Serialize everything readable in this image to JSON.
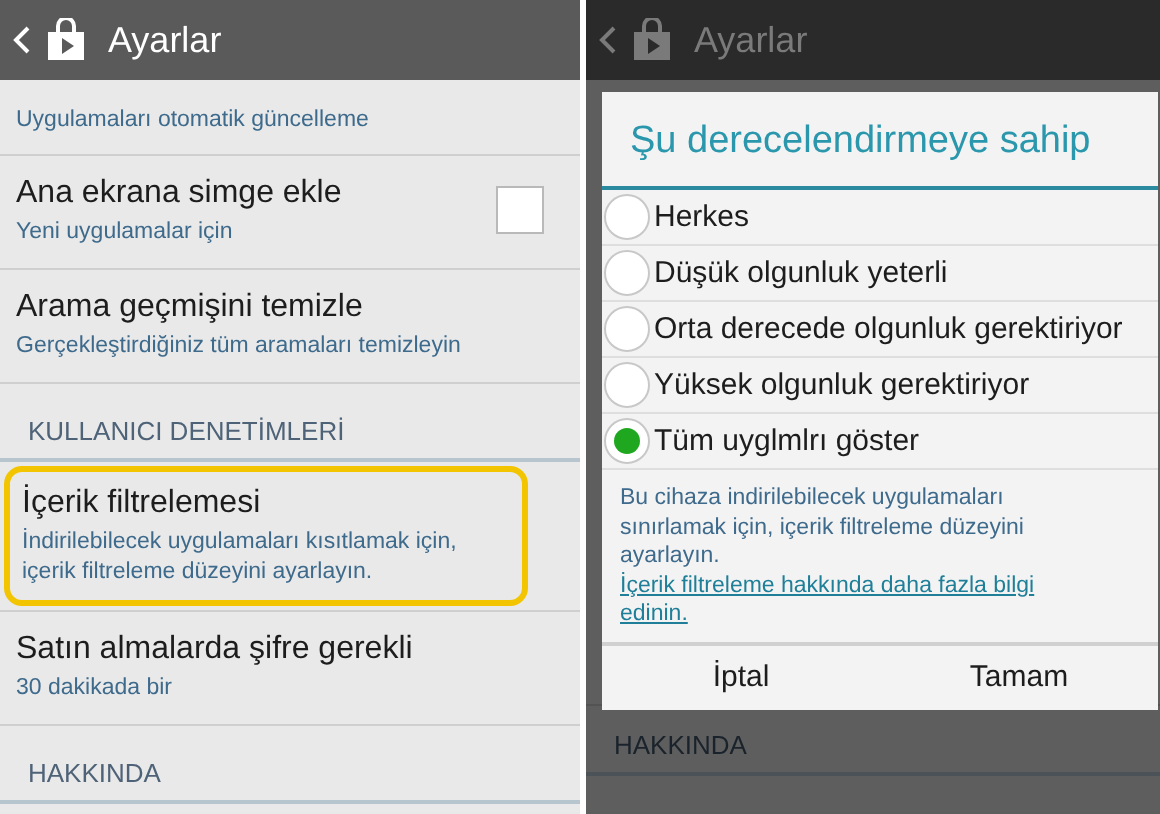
{
  "left_screen": {
    "action_bar": {
      "title": "Ayarlar"
    },
    "items": [
      {
        "kind": "item",
        "subtitle": "Uygulamaları otomatik güncelleme"
      },
      {
        "kind": "item",
        "title": "Ana ekrana simge ekle",
        "subtitle": "Yeni uygulamalar için",
        "checkbox": {
          "checked": false
        }
      },
      {
        "kind": "item",
        "title": "Arama geçmişini temizle",
        "subtitle": "Gerçekleştirdiğiniz tüm aramaları temizleyin"
      },
      {
        "kind": "header",
        "title": "KULLANICI DENETİMLERİ"
      },
      {
        "kind": "item",
        "title": "İçerik filtrelemesi",
        "subtitle": "İndirilebilecek uygulamaları kısıtlamak için, içerik filtreleme düzeyini ayarlayın.",
        "highlighted": true
      },
      {
        "kind": "item",
        "title": "Satın almalarda şifre gerekli",
        "subtitle": "30 dakikada bir"
      },
      {
        "kind": "header",
        "title": "HAKKINDA"
      }
    ]
  },
  "right_screen": {
    "action_bar": {
      "title": "Ayarlar"
    },
    "items": [
      {
        "kind": "header",
        "title": "HAKKINDA"
      }
    ],
    "dialog": {
      "title": "Şu derecelendirmeye sahip",
      "options": [
        {
          "label": "Herkes",
          "selected": false
        },
        {
          "label": "Düşük olgunluk yeterli",
          "selected": false
        },
        {
          "label": "Orta derecede olgunluk gerektiriyor",
          "selected": false
        },
        {
          "label": "Yüksek olgunluk gerektiriyor",
          "selected": false
        },
        {
          "label": "Tüm uyglmlrı göster",
          "selected": true
        }
      ],
      "description": "Bu cihaza indirilebilecek uygulamaları sınırlamak için, içerik filtreleme düzeyini ayarlayın.",
      "link": "İçerik filtreleme hakkında daha fazla bilgi edinin.",
      "buttons": [
        "İptal",
        "Tamam"
      ]
    }
  }
}
